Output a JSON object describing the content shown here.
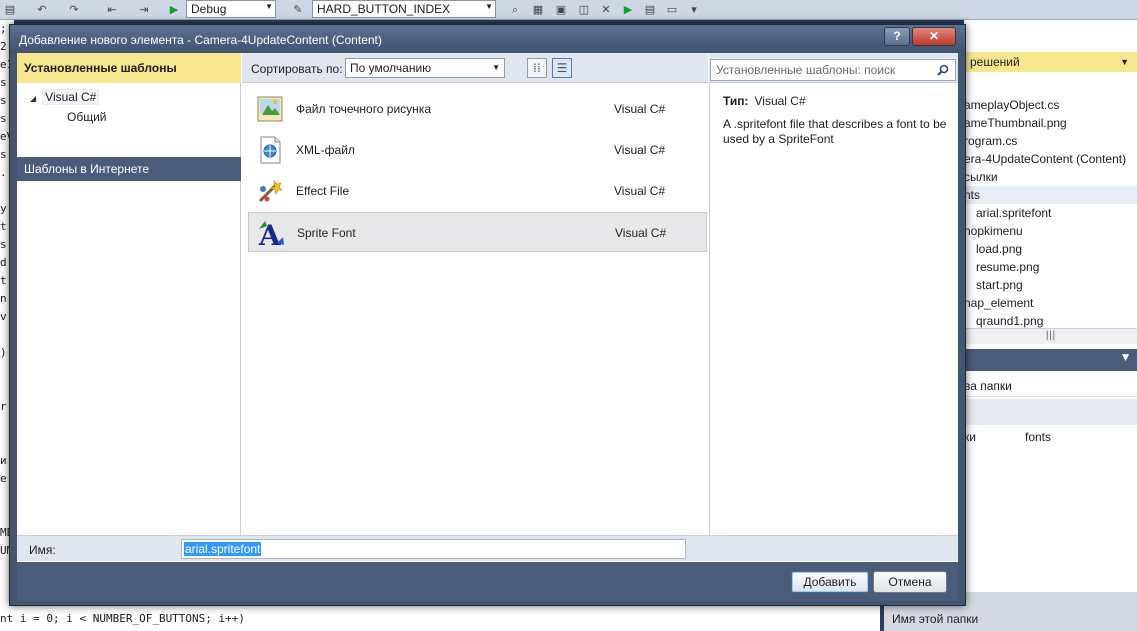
{
  "ide": {
    "config_combo": "Debug",
    "target_combo": "HARD_BUTTON_INDEX",
    "code_bottom_line": "nt i = 0; i < NUMBER_OF_BUTTONS; i++)",
    "code_left_lines": [
      ";",
      "2",
      "e1",
      "s",
      "s",
      "s",
      "eV",
      "s",
      ".",
      "",
      "y",
      "t",
      "s",
      "d",
      "t",
      "n",
      "v",
      "",
      "):",
      "",
      "",
      "r",
      "",
      "",
      "и",
      "е",
      "",
      "",
      "MB",
      "UM"
    ],
    "solution_explorer": {
      "header": "решений",
      "items": [
        "ameplayObject.cs",
        "ameThumbnail.png",
        "rogram.cs",
        "era-4UpdateContent (Content)",
        "сылки",
        "nts",
        "arial.spritefont",
        "nopkimenu",
        "load.png",
        "resume.png",
        "start.png",
        "nap_element",
        "qraund1.png"
      ]
    },
    "properties": {
      "row1": "ва папки",
      "row2_label": "ки",
      "row2_value": "fonts"
    },
    "folder_name": "Имя этой папки"
  },
  "dialog": {
    "title": "Добавление нового элемента - Camera-4UpdateContent (Content)",
    "help_label": "?",
    "close_label": "✕",
    "left": {
      "installed_header": "Установленные шаблоны",
      "tree_root": "Visual C#",
      "tree_child": "Общий",
      "online_header": "Шаблоны в Интернете"
    },
    "sort": {
      "label": "Сортировать по:",
      "value": "По умолчанию"
    },
    "search": {
      "placeholder": "Установленные шаблоны: поиск"
    },
    "templates": [
      {
        "name": "Файл точечного рисунка",
        "lang": "Visual C#",
        "icon": "bitmap-icon"
      },
      {
        "name": "XML-файл",
        "lang": "Visual C#",
        "icon": "xml-file-icon"
      },
      {
        "name": "Effect File",
        "lang": "Visual C#",
        "icon": "effect-file-icon"
      },
      {
        "name": "Sprite Font",
        "lang": "Visual C#",
        "icon": "sprite-font-icon",
        "selected": true
      }
    ],
    "info": {
      "type_label": "Тип:",
      "type_value": "Visual C#",
      "description": "A .spritefont file that describes a font to be used by a SpriteFont"
    },
    "name_label": "Имя:",
    "name_value": "arial.spritefont",
    "add_button": "Добавить",
    "cancel_button": "Отмена"
  },
  "colors": {
    "accent_yellow": "#f6e78e",
    "header_blue": "#4b5c7a",
    "selection_blue": "#3399ff"
  }
}
